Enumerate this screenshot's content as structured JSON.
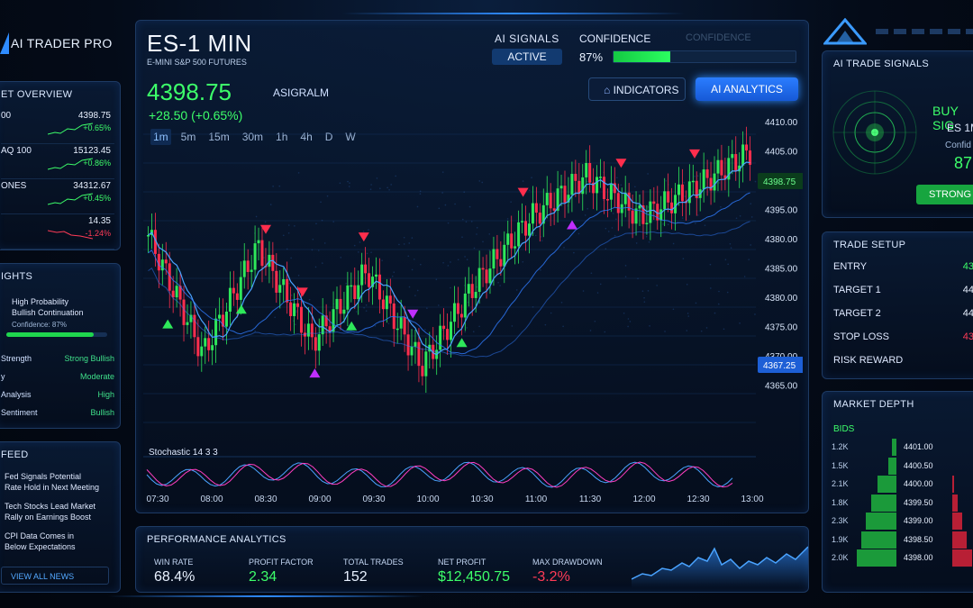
{
  "brand": {
    "name": "AI TRADER PRO"
  },
  "market_overview": {
    "title": "ET OVERVIEW",
    "rows": [
      {
        "label": "00",
        "value": "4398.75",
        "change": "+0.65%",
        "color": "#3dff6a"
      },
      {
        "label": "AQ 100",
        "value": "15123.45",
        "change": "+0.86%",
        "color": "#3dff6a"
      },
      {
        "label": "ONES",
        "value": "34312.67",
        "change": "+0.45%",
        "color": "#3dff6a"
      },
      {
        "label": "",
        "value": "14.35",
        "change": "-1.24%",
        "color": "#ff3b57"
      }
    ]
  },
  "insights": {
    "title": "IGHTS",
    "headline1": "High Probability",
    "headline2": "Bullish Continuation",
    "confidence": "Confidence: 87%",
    "bar_label": "87",
    "rows": [
      {
        "label": "Strength",
        "value": "Strong Bullish"
      },
      {
        "label": "y",
        "value": "Moderate"
      },
      {
        "label": "Analysis",
        "value": "High"
      },
      {
        "label": "Sentiment",
        "value": "Bullish"
      }
    ]
  },
  "news": {
    "title": "FEED",
    "items": [
      {
        "l1": "Fed Signals Potential",
        "l2": "Rate Hold in Next Meeting"
      },
      {
        "l1": "Tech Stocks Lead Market",
        "l2": "Rally on Earnings Boost"
      },
      {
        "l1": "CPI Data Comes in",
        "l2": "Below Expectations"
      }
    ],
    "view_all": "VIEW ALL NEWS"
  },
  "main": {
    "symbol": "ES-1 MIN",
    "subtitle": "E-MINI S&P 500 FUTURES",
    "ai_signals_label": "AI SIGNALS",
    "ai_signals_status": "ACTIVE",
    "confidence_label": "CONFIDENCE",
    "confidence_value": "87%",
    "confidence_fraction": 0.87,
    "faded_label": "CONFIDENCE",
    "price": "4398.75",
    "change": "+28.50 (+0.65%)",
    "overlay_label": "ASIGRALM",
    "timeframes": [
      "1m",
      "5m",
      "15m",
      "30m",
      "1h",
      "4h",
      "D",
      "W"
    ],
    "indicators_button": "INDICATORS",
    "ai_analytics_button": "AI ANALYTICS",
    "price_tag_current": "4398.75",
    "price_tag_low": "4367.25",
    "y_ticks": [
      "4410.00",
      "4405.00",
      "4400.00",
      "4395.00",
      "4380.00",
      "4385.00",
      "4380.00",
      "4375.00",
      "4370.00",
      "4365.00"
    ],
    "x_ticks": [
      "07:30",
      "08:00",
      "08:30",
      "09:00",
      "09:30",
      "10:00",
      "10:30",
      "11:00",
      "11:30",
      "12:00",
      "12:30",
      "13:00"
    ],
    "stoch_label": "Stochastic 14 3 3"
  },
  "performance": {
    "title": "PERFORMANCE ANALYTICS",
    "metrics": [
      {
        "label": "WIN RATE",
        "value": "68.4%",
        "color": "#e8f1ff"
      },
      {
        "label": "PROFIT FACTOR",
        "value": "2.34",
        "color": "#3dff6a"
      },
      {
        "label": "TOTAL TRADES",
        "value": "152",
        "color": "#e8f1ff"
      },
      {
        "label": "NET PROFIT",
        "value": "$12,450.75",
        "color": "#3dff6a"
      },
      {
        "label": "MAX DRAWDOWN",
        "value": "-3.2%",
        "color": "#ff3b57"
      }
    ]
  },
  "signals_panel": {
    "title": "AI TRADE SIGNALS",
    "signal": "BUY SIG",
    "instrument": "ES 1M",
    "conf_label": "Confid",
    "conf_value": "87",
    "button": "STRONG B"
  },
  "trade_setup": {
    "title": "TRADE SETUP",
    "rows": [
      {
        "label": "ENTRY",
        "value": "43",
        "color": "#3dff6a"
      },
      {
        "label": "TARGET 1",
        "value": "44",
        "color": "#e8f1ff"
      },
      {
        "label": "TARGET 2",
        "value": "44",
        "color": "#e8f1ff"
      },
      {
        "label": "STOP LOSS",
        "value": "43",
        "color": "#ff3b57"
      },
      {
        "label": "RISK REWARD",
        "value": "",
        "color": "#e8f1ff"
      }
    ]
  },
  "depth": {
    "title": "MARKET DEPTH",
    "bids_label": "BIDS",
    "rows": [
      {
        "size": "1.2K",
        "price": "4401.00",
        "bid": 0.1,
        "ask": 0
      },
      {
        "size": "1.5K",
        "price": "4400.50",
        "bid": 0.2,
        "ask": 0
      },
      {
        "size": "2.1K",
        "price": "4400.00",
        "bid": 0.45,
        "ask": 0.05
      },
      {
        "size": "1.8K",
        "price": "4399.50",
        "bid": 0.6,
        "ask": 0.2
      },
      {
        "size": "2.3K",
        "price": "4399.00",
        "bid": 0.75,
        "ask": 0.35
      },
      {
        "size": "1.9K",
        "price": "4398.50",
        "bid": 0.85,
        "ask": 0.5
      },
      {
        "size": "2.0K",
        "price": "4398.00",
        "bid": 0.95,
        "ask": 0.7
      }
    ]
  },
  "chart_data": {
    "type": "line",
    "title": "ES-1 MIN",
    "x": [
      "07:30",
      "08:00",
      "08:30",
      "09:00",
      "09:30",
      "10:00",
      "10:30",
      "11:00",
      "11:30",
      "12:00",
      "12:30",
      "13:00"
    ],
    "series": [
      {
        "values": [
          4392,
          4372,
          4390,
          4374,
          4386,
          4370,
          4384,
          4395,
          4402,
          4395,
          4400,
          4406
        ]
      }
    ],
    "ylim": [
      4362,
      4412
    ]
  }
}
